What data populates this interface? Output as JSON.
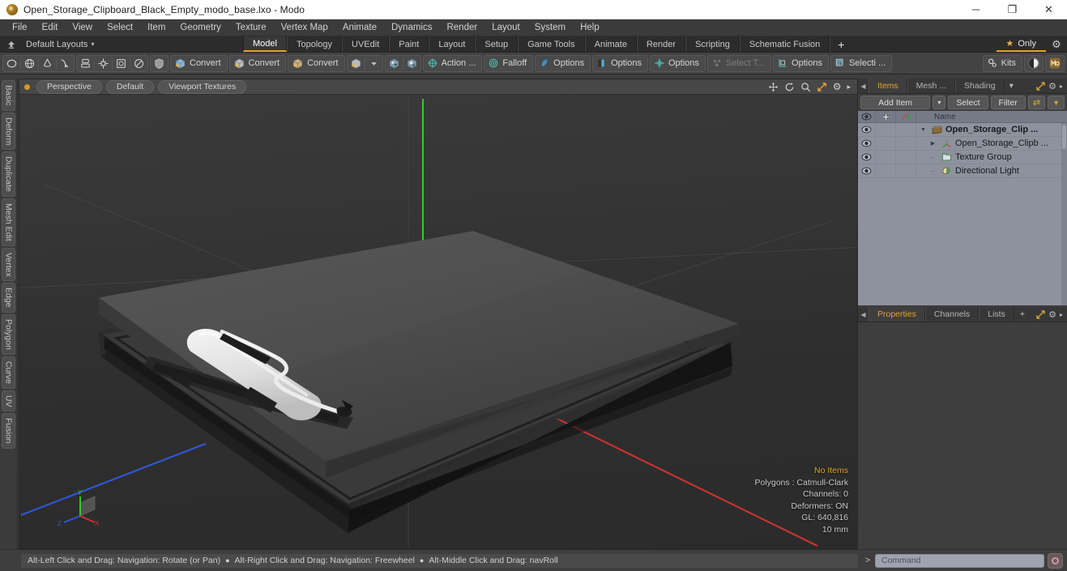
{
  "window": {
    "title": "Open_Storage_Clipboard_Black_Empty_modo_base.lxo - Modo",
    "app_icon": "modo-logo-icon",
    "minimize": "─",
    "maximize": "❐",
    "close": "✕"
  },
  "menubar": {
    "items": [
      {
        "label": "File"
      },
      {
        "label": "Edit"
      },
      {
        "label": "View"
      },
      {
        "label": "Select"
      },
      {
        "label": "Item"
      },
      {
        "label": "Geometry"
      },
      {
        "label": "Texture"
      },
      {
        "label": "Vertex Map"
      },
      {
        "label": "Animate"
      },
      {
        "label": "Dynamics"
      },
      {
        "label": "Render"
      },
      {
        "label": "Layout"
      },
      {
        "label": "System"
      },
      {
        "label": "Help"
      }
    ]
  },
  "layoutbar": {
    "layout_name": "Default Layouts",
    "caret": "▾",
    "tabs": [
      {
        "label": "Model",
        "active": true
      },
      {
        "label": "Topology",
        "active": false
      },
      {
        "label": "UVEdit",
        "active": false
      },
      {
        "label": "Paint",
        "active": false
      },
      {
        "label": "Layout",
        "active": false
      },
      {
        "label": "Setup",
        "active": false
      },
      {
        "label": "Game Tools",
        "active": false
      },
      {
        "label": "Animate",
        "active": false
      },
      {
        "label": "Render",
        "active": false
      },
      {
        "label": "Scripting",
        "active": false
      },
      {
        "label": "Schematic Fusion",
        "active": false
      }
    ],
    "add_tab": "+",
    "only_label": "Only",
    "star_glyph": "★",
    "gear_glyph": "⚙"
  },
  "toolbar": {
    "groups": [
      {
        "name": "primitives",
        "buttons": [
          {
            "icon": "ellipse-icon",
            "label": ""
          },
          {
            "icon": "globe-icon",
            "label": ""
          },
          {
            "icon": "cone-icon",
            "label": ""
          },
          {
            "icon": "pen-icon",
            "label": ""
          }
        ]
      },
      {
        "name": "mesh-ops",
        "buttons": [
          {
            "icon": "stack-icon",
            "label": ""
          },
          {
            "icon": "array-icon",
            "label": ""
          },
          {
            "icon": "frame-icon",
            "label": ""
          },
          {
            "icon": "circle-slice-icon",
            "label": ""
          }
        ]
      },
      {
        "name": "shield",
        "buttons": [
          {
            "icon": "shield-icon",
            "label": ""
          }
        ]
      },
      {
        "name": "convert-1",
        "buttons": [
          {
            "icon": "convert-box-blue-icon",
            "label": "Convert"
          }
        ]
      },
      {
        "name": "convert-2",
        "buttons": [
          {
            "icon": "convert-box-yellow-icon",
            "label": "Convert"
          }
        ]
      },
      {
        "name": "convert-3",
        "buttons": [
          {
            "icon": "convert-box-orange-icon",
            "label": "Convert"
          }
        ]
      },
      {
        "name": "box-dropdown",
        "buttons": [
          {
            "icon": "box-icon",
            "label": ""
          },
          {
            "icon": "chevron-down-icon",
            "label": ""
          }
        ]
      },
      {
        "name": "shaded-modes",
        "buttons": [
          {
            "icon": "shade-sphere-a-icon",
            "label": ""
          },
          {
            "icon": "shade-sphere-b-icon",
            "label": ""
          }
        ]
      },
      {
        "name": "action-center",
        "buttons": [
          {
            "icon": "action-center-icon",
            "label": "Action  ..."
          }
        ]
      },
      {
        "name": "falloff",
        "buttons": [
          {
            "icon": "falloff-icon",
            "label": "Falloff"
          }
        ]
      },
      {
        "name": "options-snap",
        "buttons": [
          {
            "icon": "snap-icon",
            "label": "Options"
          }
        ]
      },
      {
        "name": "options-symmetry",
        "buttons": [
          {
            "icon": "symmetry-icon",
            "label": "Options"
          }
        ]
      },
      {
        "name": "options-workplane",
        "buttons": [
          {
            "icon": "workplane-icon",
            "label": "Options"
          }
        ]
      },
      {
        "name": "select-through",
        "buttons": [
          {
            "icon": "select-through-icon",
            "label": "Select T...",
            "disabled": true
          }
        ]
      },
      {
        "name": "options-element",
        "buttons": [
          {
            "icon": "element-icon",
            "label": "Options"
          }
        ]
      },
      {
        "name": "selection-sets",
        "buttons": [
          {
            "icon": "selection-icon",
            "label": "Selecti ..."
          }
        ]
      },
      {
        "name": "kits",
        "buttons": [
          {
            "icon": "kits-icon",
            "label": "Kits"
          }
        ]
      },
      {
        "name": "preview-render",
        "buttons": [
          {
            "icon": "preview-render-icon",
            "label": ""
          }
        ]
      },
      {
        "name": "modo-badge",
        "buttons": [
          {
            "icon": "modo-badge-icon",
            "label": ""
          }
        ]
      }
    ]
  },
  "left_rail": {
    "tabs": [
      {
        "label": "Basic"
      },
      {
        "label": "Deform"
      },
      {
        "label": "Duplicate"
      },
      {
        "label": "Mesh Edit"
      },
      {
        "label": "Vertex"
      },
      {
        "label": "Edge"
      },
      {
        "label": "Polygon"
      },
      {
        "label": "Curve"
      },
      {
        "label": "UV"
      },
      {
        "label": "Fusion"
      }
    ]
  },
  "viewport": {
    "chips": [
      {
        "label": "Perspective",
        "name": "viewport-view-mode"
      },
      {
        "label": "Default",
        "name": "viewport-shading-preset"
      },
      {
        "label": "Viewport Textures",
        "name": "viewport-textures"
      }
    ],
    "header_icons": [
      {
        "name": "pan-icon",
        "glyph": "✥"
      },
      {
        "name": "rotate-icon",
        "glyph": "↻"
      },
      {
        "name": "zoom-icon",
        "glyph": "⌕"
      },
      {
        "name": "fit-icon",
        "glyph": "↗"
      },
      {
        "name": "viewport-settings-gear-icon",
        "glyph": "⚙"
      },
      {
        "name": "viewport-more-arrow-icon",
        "glyph": "▸"
      }
    ],
    "info": {
      "selection": "No Items",
      "polygons": "Polygons : Catmull-Clark",
      "channels": "Channels: 0",
      "deformers": "Deformers: ON",
      "gl": "GL: 640,816",
      "scale": "10 mm"
    },
    "axis_labels": {
      "x": "X",
      "y": "Y",
      "z": "Z"
    },
    "axis_colors": {
      "x": "#c44040",
      "y": "#3fbf3f",
      "z": "#3a5fd0"
    }
  },
  "right_panel": {
    "top_tabs": [
      {
        "label": "Items",
        "active": true
      },
      {
        "label": "Mesh ...",
        "active": false
      },
      {
        "label": "Shading",
        "active": false
      }
    ],
    "top_tabs_caret": "▾",
    "toolrow": {
      "add_item": "Add Item",
      "add_item_caret": "▾",
      "select": "Select",
      "filter": "Filter",
      "swap_glyph": "⇄",
      "funnel_glyph": "▼"
    },
    "columns": {
      "visibility": "eye-icon",
      "lock": "plus-icon",
      "render": "render-icon",
      "name": "Name"
    },
    "items": [
      {
        "label": "Open_Storage_Clip ...",
        "icon": "group-icon",
        "depth": 0,
        "twisty": "▼",
        "bold": true
      },
      {
        "label": "Open_Storage_Clipb ...",
        "icon": "mesh-icon",
        "depth": 1,
        "twisty": "▶",
        "bold": false
      },
      {
        "label": "Texture Group",
        "icon": "texture-group-icon",
        "depth": 1,
        "twisty": "",
        "bold": false
      },
      {
        "label": "Directional Light",
        "icon": "light-icon",
        "depth": 1,
        "twisty": "",
        "bold": false
      }
    ],
    "bottom_tabs": [
      {
        "label": "Properties",
        "active": true
      },
      {
        "label": "Channels",
        "active": false
      },
      {
        "label": "Lists",
        "active": false
      }
    ],
    "bottom_tabs_plus": "+",
    "bottom_tabs_expand": "⤡",
    "bottom_tabs_gear": "⚙",
    "bottom_tabs_more": "▸"
  },
  "statusbar": {
    "hints": [
      "Alt-Left Click and Drag: Navigation: Rotate (or Pan)",
      "Alt-Right Click and Drag: Navigation: Freewheel",
      "Alt-Middle Click and Drag: navRoll"
    ],
    "separator": "●",
    "command_prompt": ">",
    "command_placeholder": "Command",
    "record_icon": "record-icon"
  },
  "colors": {
    "accent": "#e8a033",
    "panel_bg": "#3e3e3e",
    "toolbar_bg": "#434343",
    "list_bg": "#8d929c",
    "viewport_bg": "#313131"
  }
}
